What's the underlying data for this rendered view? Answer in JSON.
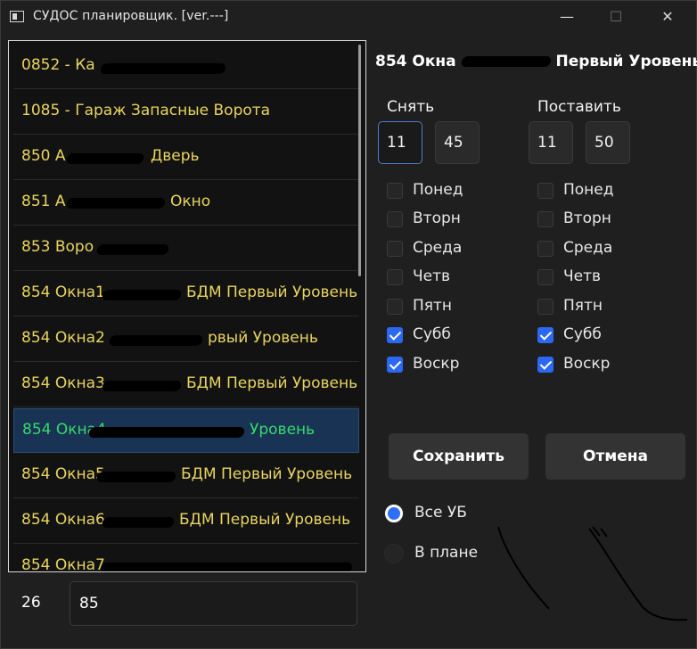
{
  "window": {
    "title": "СУДОС планировщик. [ver.---]",
    "minimize": "—",
    "maximize": "☐",
    "close": "✕"
  },
  "list": {
    "items": [
      "0852 - Ка",
      "1085 - Гараж Запасные Ворота",
      "850 А",
      "851 А",
      "853 Воро",
      "854 Окна1",
      "854 Окна2",
      "854 Окна3",
      "854 Окна4",
      "854 Окна5",
      "854 Окна6",
      "854 Окна7"
    ],
    "selected_index": 8
  },
  "counter": {
    "count": "26",
    "value": "85"
  },
  "details": {
    "title": "854 Окна",
    "remove_label": "Снять",
    "set_label": "Поставить",
    "remove_time": {
      "hours": "11",
      "minutes": "45"
    },
    "set_time": {
      "hours": "11",
      "minutes": "50"
    },
    "days": [
      "Понед",
      "Вторн",
      "Среда",
      "Четв",
      "Пятн",
      "Субб",
      "Воскр"
    ],
    "remove_checked": [
      false,
      false,
      false,
      false,
      false,
      true,
      true
    ],
    "set_checked": [
      false,
      false,
      false,
      false,
      false,
      true,
      true
    ],
    "save_button": "Сохранить",
    "cancel_button": "Отмена",
    "radio_all": "Все УБ",
    "radio_plan": "В плане",
    "selected_radio": "all"
  }
}
